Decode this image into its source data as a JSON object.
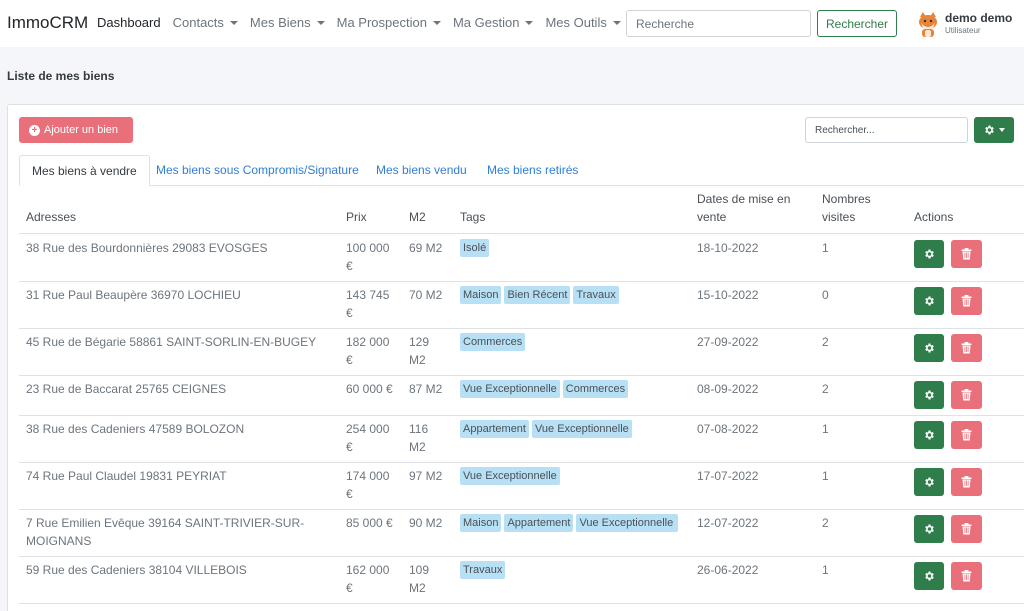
{
  "navbar": {
    "brand": "ImmoCRM",
    "items": [
      {
        "label": "Dashboard",
        "dropdown": false
      },
      {
        "label": "Contacts",
        "dropdown": true
      },
      {
        "label": "Mes Biens",
        "dropdown": true
      },
      {
        "label": "Ma Prospection",
        "dropdown": true
      },
      {
        "label": "Ma Gestion",
        "dropdown": true
      },
      {
        "label": "Mes Outils",
        "dropdown": true
      }
    ],
    "search_placeholder": "Recherche",
    "search_button": "Rechercher",
    "user_name": "demo demo",
    "user_role": "Utilisateur"
  },
  "page": {
    "title": "Liste de mes biens",
    "add_button": "Ajouter un bien",
    "search_placeholder": "Rechercher..."
  },
  "tabs": [
    {
      "label": "Mes biens à vendre",
      "active": true
    },
    {
      "label": "Mes biens sous Compromis/Signature",
      "active": false
    },
    {
      "label": "Mes biens vendu",
      "active": false
    },
    {
      "label": "Mes biens retirés",
      "active": false
    }
  ],
  "table": {
    "headers": {
      "address": "Adresses",
      "price": "Prix",
      "m2": "M2",
      "tags": "Tags",
      "dates_1": "Dates de mise en",
      "dates_2": "vente",
      "visits_1": "Nombres",
      "visits_2": "visites",
      "actions": "Actions"
    },
    "rows": [
      {
        "addr1": "38 Rue des Bourdonnières 29083 EVOSGES",
        "addr2": "",
        "price1": "100 000",
        "price2": "€",
        "m2a": "69 M2",
        "m2b": "",
        "tags": [
          "Isolé"
        ],
        "date": "18-10-2022",
        "visits": "1"
      },
      {
        "addr1": "31 Rue Paul Beaupère 36970 LOCHIEU",
        "addr2": "",
        "price1": "143 745",
        "price2": "€",
        "m2a": "70 M2",
        "m2b": "",
        "tags": [
          "Maison",
          "Bien Récent",
          "Travaux"
        ],
        "date": "15-10-2022",
        "visits": "0"
      },
      {
        "addr1": "45 Rue de Bégarie 58861 SAINT-SORLIN-EN-BUGEY",
        "addr2": "",
        "price1": "182 000",
        "price2": "€",
        "m2a": "129",
        "m2b": "M2",
        "tags": [
          "Commerces"
        ],
        "date": "27-09-2022",
        "visits": "2"
      },
      {
        "addr1": "23 Rue de Baccarat 25765 CEIGNES",
        "addr2": "",
        "price1": "60 000 €",
        "price2": "",
        "m2a": "87 M2",
        "m2b": "",
        "tags": [
          "Vue Exceptionnelle",
          "Commerces"
        ],
        "date": "08-09-2022",
        "visits": "2"
      },
      {
        "addr1": "38 Rue des Cadeniers 47589 BOLOZON",
        "addr2": "",
        "price1": "254 000",
        "price2": "€",
        "m2a": "116",
        "m2b": "M2",
        "tags": [
          "Appartement",
          "Vue Exceptionnelle"
        ],
        "date": "07-08-2022",
        "visits": "1"
      },
      {
        "addr1": "74 Rue Paul Claudel 19831 PEYRIAT",
        "addr2": "",
        "price1": "174 000",
        "price2": "€",
        "m2a": "97 M2",
        "m2b": "",
        "tags": [
          "Vue Exceptionnelle"
        ],
        "date": "17-07-2022",
        "visits": "1"
      },
      {
        "addr1": "7 Rue Emilien Evêque 39164 SAINT-TRIVIER-SUR-",
        "addr2": "MOIGNANS",
        "price1": "85 000 €",
        "price2": "",
        "m2a": "90 M2",
        "m2b": "",
        "tags": [
          "Maison",
          "Appartement",
          "Vue Exceptionnelle"
        ],
        "date": "12-07-2022",
        "visits": "2"
      },
      {
        "addr1": "59 Rue des Cadeniers 38104 VILLEBOIS",
        "addr2": "",
        "price1": "162 000",
        "price2": "€",
        "m2a": "109",
        "m2b": "M2",
        "tags": [
          "Travaux"
        ],
        "date": "26-06-2022",
        "visits": "1"
      }
    ]
  },
  "icons": {
    "gear": "gear-icon",
    "trash": "trash-icon",
    "plus": "plus-circle-icon"
  },
  "colors": {
    "success": "#2f7d4a",
    "danger": "#e9707b",
    "link": "#2f7ed8",
    "tag": "#b8e0f5"
  }
}
